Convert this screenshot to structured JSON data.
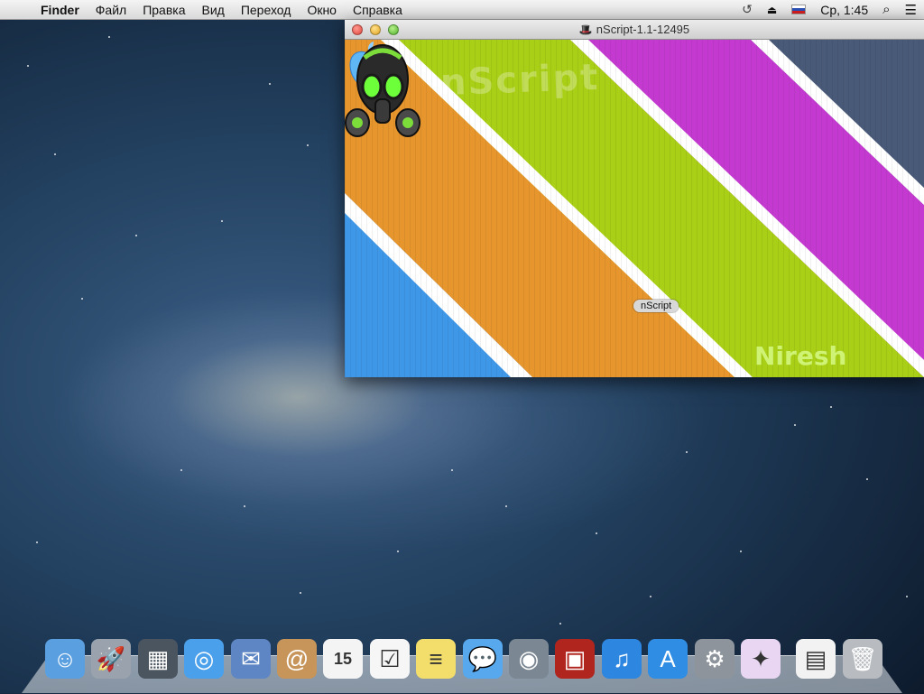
{
  "menubar": {
    "apple_icon": "",
    "app_name": "Finder",
    "menus": [
      "Файл",
      "Правка",
      "Вид",
      "Переход",
      "Окно",
      "Справка"
    ],
    "status_icons": [
      "time-machine-icon",
      "eject-icon",
      "russian-flag-icon"
    ],
    "clock": "Ср, 1:45",
    "spotlight_icon": "search-icon",
    "notification_icon": "list-icon"
  },
  "window": {
    "title": "nScript-1.1-12495",
    "background": {
      "watermark_top": "nScript",
      "watermark_bottom": "Niresh",
      "stripe_colors": [
        "#3f97e8",
        "#e7952d",
        "#a9cf16",
        "#c43ad0",
        "#495a78"
      ]
    },
    "item": {
      "name": "nScript",
      "icon": "gas-mask-icon"
    }
  },
  "dock": {
    "items": [
      {
        "name": "Finder",
        "icon": "finder-icon",
        "bg": "#5a9fe0",
        "glyph": "☺"
      },
      {
        "name": "Launchpad",
        "icon": "launchpad-icon",
        "bg": "#9aa3ad",
        "glyph": "🚀"
      },
      {
        "name": "Mission Control",
        "icon": "mission-control-icon",
        "bg": "#4b5560",
        "glyph": "▦"
      },
      {
        "name": "Safari",
        "icon": "safari-icon",
        "bg": "#4aa0ea",
        "glyph": "◎"
      },
      {
        "name": "Mail",
        "icon": "mail-icon",
        "bg": "#5e86c4",
        "glyph": "✉"
      },
      {
        "name": "Contacts",
        "icon": "contacts-icon",
        "bg": "#c7955a",
        "glyph": "@"
      },
      {
        "name": "Calendar",
        "icon": "calendar-icon",
        "bg": "#f4f4f4",
        "glyph": "15"
      },
      {
        "name": "Reminders",
        "icon": "reminders-icon",
        "bg": "#f6f6f6",
        "glyph": "☑"
      },
      {
        "name": "Notes",
        "icon": "notes-icon",
        "bg": "#f3dd6b",
        "glyph": "≡"
      },
      {
        "name": "Messages",
        "icon": "messages-icon",
        "bg": "#58a8ee",
        "glyph": "💬"
      },
      {
        "name": "FaceTime",
        "icon": "facetime-icon",
        "bg": "#7b8793",
        "glyph": "◉"
      },
      {
        "name": "Photo Booth",
        "icon": "photo-booth-icon",
        "bg": "#b0261f",
        "glyph": "▣"
      },
      {
        "name": "iTunes",
        "icon": "itunes-icon",
        "bg": "#2d86e0",
        "glyph": "♫"
      },
      {
        "name": "App Store",
        "icon": "app-store-icon",
        "bg": "#2f8de4",
        "glyph": "A"
      },
      {
        "name": "System Preferences",
        "icon": "system-preferences-icon",
        "bg": "#8d949c",
        "glyph": "⚙"
      },
      {
        "name": "Wizard",
        "icon": "wizard-icon",
        "bg": "#e8d6f2",
        "glyph": "✦"
      },
      {
        "name": "Document",
        "icon": "document-icon",
        "bg": "#f2f2f2",
        "glyph": "▤"
      },
      {
        "name": "Trash",
        "icon": "trash-icon",
        "bg": "#b8bcc0",
        "glyph": "🗑"
      }
    ]
  }
}
